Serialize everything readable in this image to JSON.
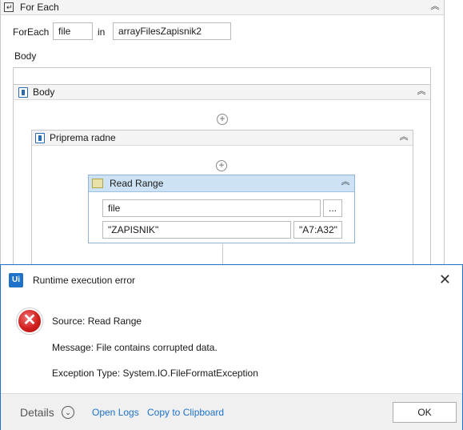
{
  "foreach": {
    "title": "For Each",
    "foreach_label": "ForEach",
    "item_value": "file",
    "in_label": "in",
    "collection_value": "arrayFilesZapisnik2",
    "body_label": "Body"
  },
  "body_sequence": {
    "title": "Body"
  },
  "sequence": {
    "title": "Priprema radne"
  },
  "read_range": {
    "title": "Read Range",
    "workbook_value": "file",
    "browse_label": "...",
    "sheet_value": "\"ZAPISNIK\"",
    "range_value": "\"A7:A32\""
  },
  "dialog": {
    "logo_text": "Ui",
    "title": "Runtime execution error",
    "close_glyph": "✕",
    "source_line": "Source: Read Range",
    "message_line": "Message: File contains corrupted data.",
    "exception_line": "Exception Type: System.IO.FileFormatException",
    "details_label": "Details",
    "open_logs_label": "Open Logs",
    "copy_label": "Copy to Clipboard",
    "ok_label": "OK"
  },
  "icons": {
    "collapse": "chevron-double-up-icon",
    "add": "plus-circle-icon",
    "error": "error-x-icon"
  },
  "colors": {
    "accent": "#1e72c9",
    "read_range_header": "#cde3f5",
    "error_red": "#d0201e"
  }
}
